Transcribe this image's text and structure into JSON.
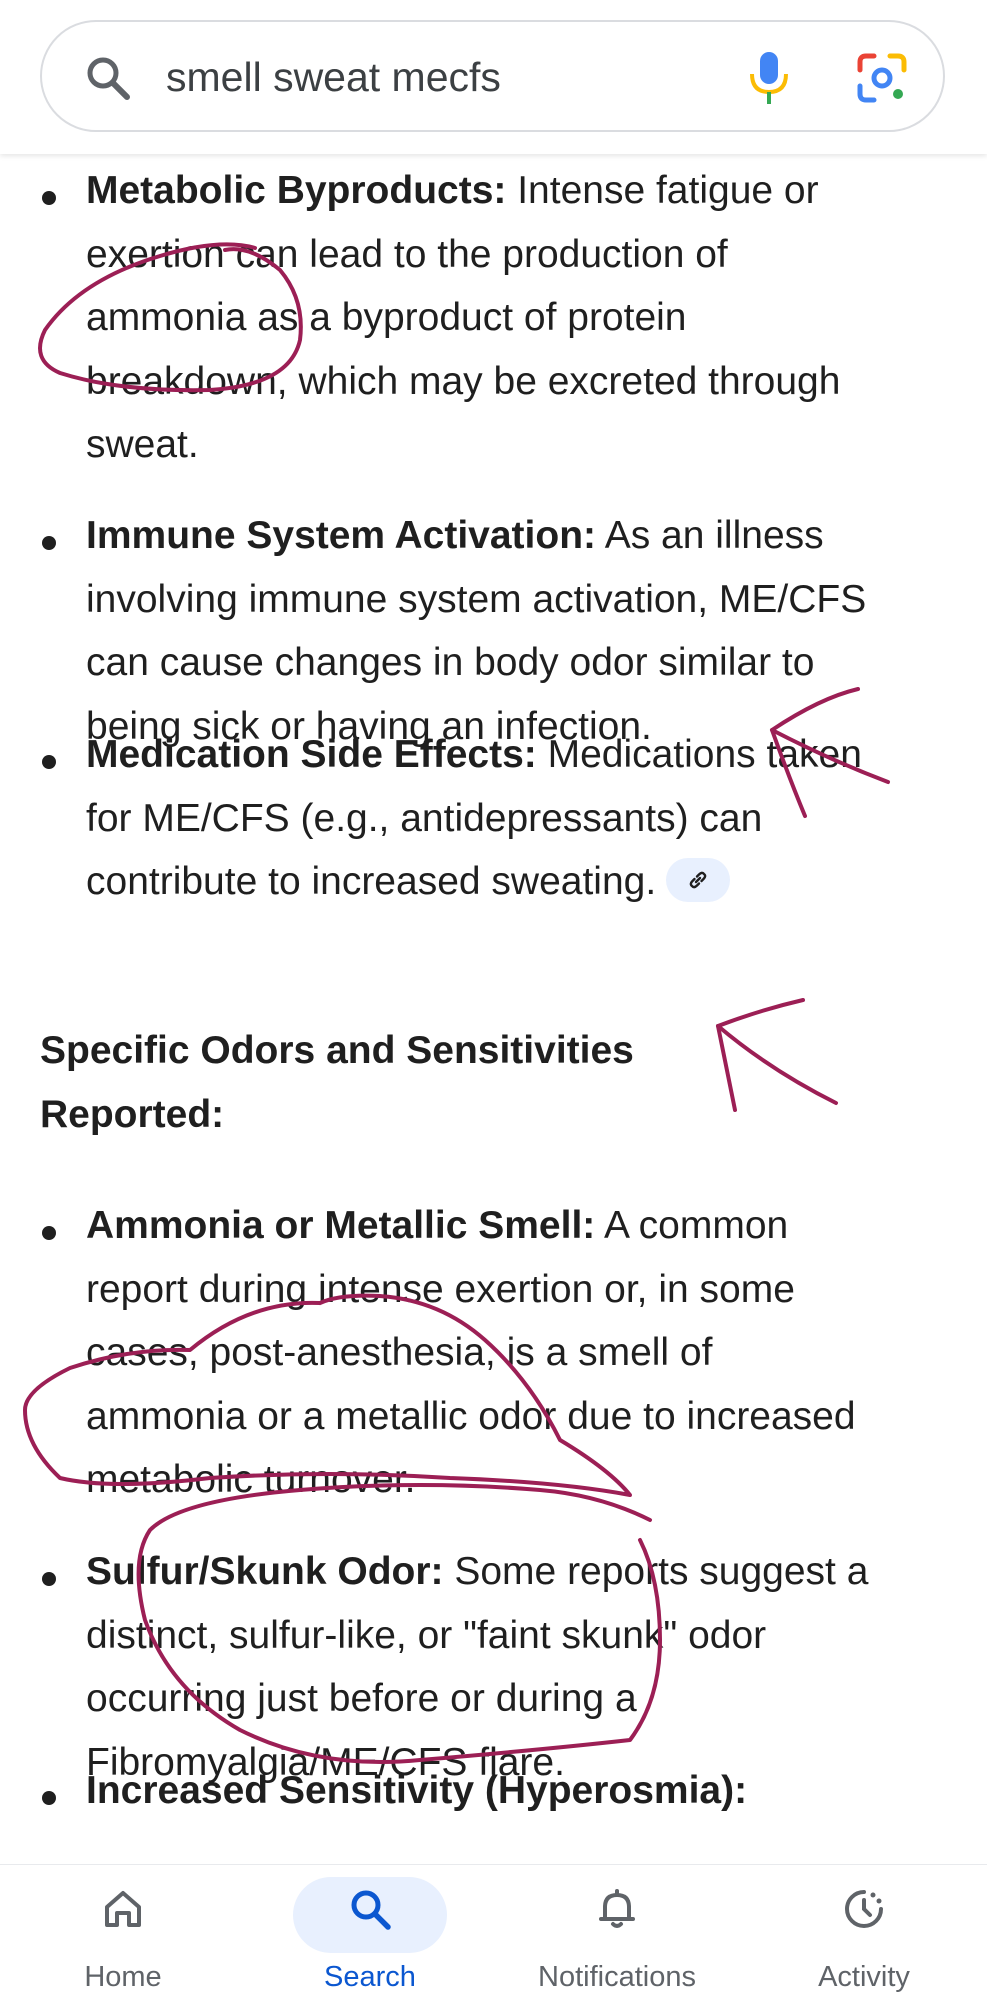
{
  "search": {
    "query": "smell sweat mecfs",
    "icons": [
      "search-icon",
      "mic-icon",
      "lens-icon"
    ]
  },
  "content": {
    "items_top": [
      {
        "title": "Metabolic Byproducts:",
        "lines": [
          " Intense fatigue or",
          "exertion can lead to the production of",
          "ammonia as a byproduct of protein",
          "breakdown, which may be excreted through",
          "sweat."
        ]
      },
      {
        "title": "Immune System Activation:",
        "lines": [
          " As an illness",
          "involving immune system activation, ME/CFS",
          "can cause changes in body odor similar to",
          "being sick or having an infection."
        ]
      },
      {
        "title": "Medication Side Effects:",
        "lines": [
          " Medications taken",
          "for ME/CFS (e.g., antidepressants) can",
          "contribute to increased sweating."
        ]
      }
    ],
    "section_heading_1": "Specific Odors and Sensitivities",
    "section_heading_2": "Reported:",
    "items_bottom": [
      {
        "title": "Ammonia or Metallic Smell:",
        "lines": [
          " A common",
          "report during intense exertion or, in some",
          "cases, post-anesthesia, is a smell of",
          "ammonia or a metallic odor due to increased",
          "metabolic turnover."
        ]
      },
      {
        "title": "Sulfur/Skunk Odor:",
        "lines": [
          " Some reports suggest a",
          "distinct, sulfur-like, or \"faint skunk\" odor",
          "occurring just before or during a",
          "Fibromyalgia/ME/CFS flare."
        ]
      },
      {
        "title": "Increased Sensitivity (Hyperosmia):",
        "lines": []
      }
    ]
  },
  "nav": {
    "items": [
      {
        "label": "Home",
        "icon": "home-icon",
        "active": false
      },
      {
        "label": "Search",
        "icon": "search-icon",
        "active": true
      },
      {
        "label": "Notifications",
        "icon": "bell-icon",
        "active": false
      },
      {
        "label": "Activity",
        "icon": "activity-icon",
        "active": false
      }
    ]
  },
  "colors": {
    "ink": "#9c1f55",
    "accent": "#0b57d0",
    "pill": "#e8f0fe"
  }
}
